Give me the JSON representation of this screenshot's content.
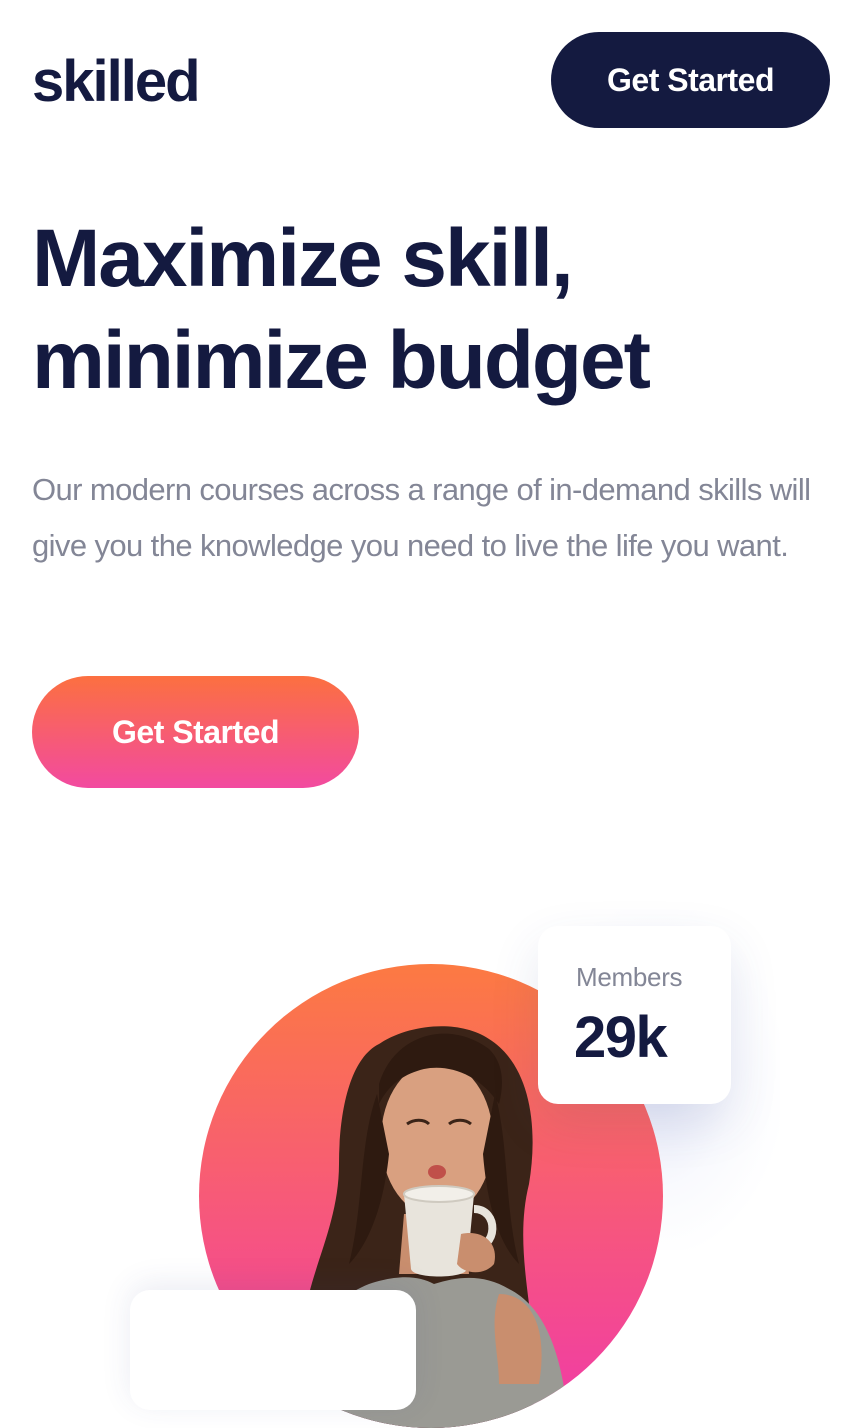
{
  "header": {
    "logo_text": "skilled",
    "cta_label": "Get Started"
  },
  "hero": {
    "title_line1": "Maximize skill,",
    "title_line2": "minimize budget",
    "description": "Our modern courses across a range of in-demand skills will give you the knowledge you need to live the life you want.",
    "cta_label": "Get Started",
    "image_alt": "Woman blowing on a cup of coffee"
  },
  "stats": {
    "members_label": "Members",
    "members_value": "29k"
  },
  "colors": {
    "navy": "#141a40",
    "gray_text": "#838696",
    "gradient_top": "#fc7040",
    "gradient_bottom": "#f24aa0",
    "background": "#ffffff"
  }
}
